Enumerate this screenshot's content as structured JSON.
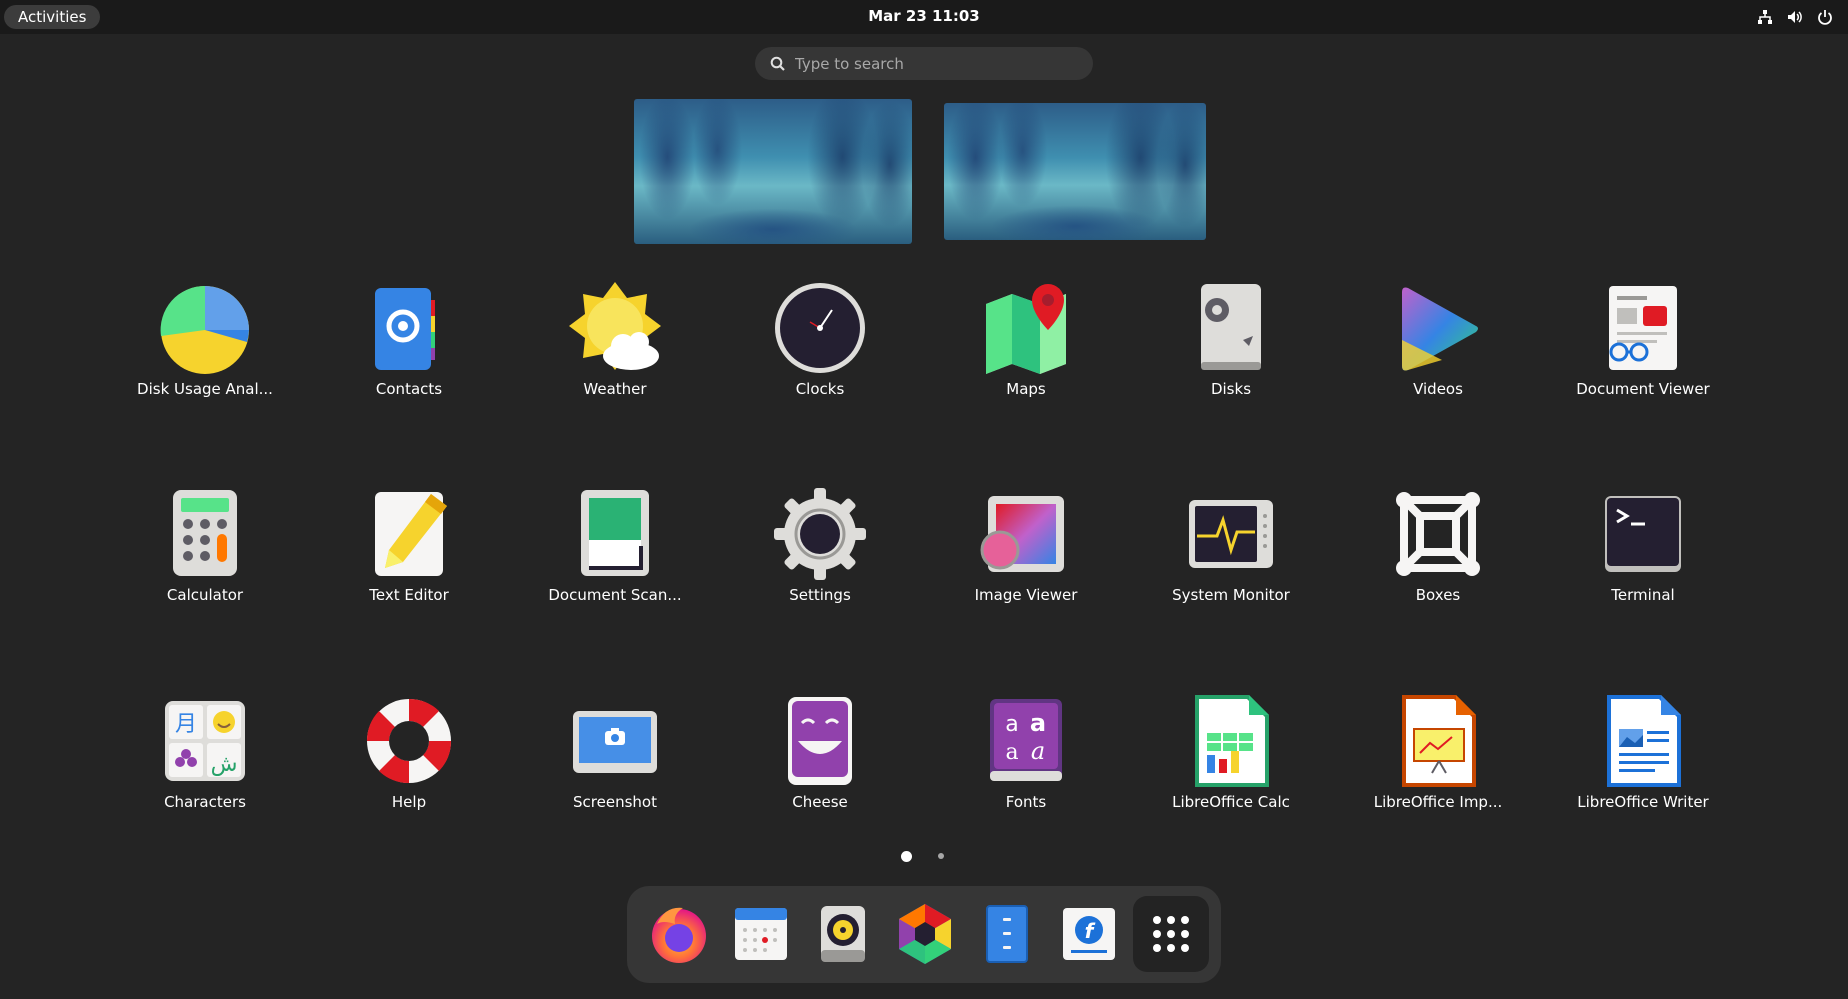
{
  "topbar": {
    "activities_label": "Activities",
    "datetime": "Mar 23  11:03",
    "tray_icons": [
      "network-icon",
      "volume-icon",
      "power-icon"
    ]
  },
  "search": {
    "placeholder": "Type to search"
  },
  "apps": [
    {
      "label": "Disk Usage Anal...",
      "icon": "disk-usage-icon"
    },
    {
      "label": "Contacts",
      "icon": "contacts-icon"
    },
    {
      "label": "Weather",
      "icon": "weather-icon"
    },
    {
      "label": "Clocks",
      "icon": "clocks-icon"
    },
    {
      "label": "Maps",
      "icon": "maps-icon"
    },
    {
      "label": "Disks",
      "icon": "disks-icon"
    },
    {
      "label": "Videos",
      "icon": "videos-icon"
    },
    {
      "label": "Document Viewer",
      "icon": "document-viewer-icon"
    },
    {
      "label": "Calculator",
      "icon": "calculator-icon"
    },
    {
      "label": "Text Editor",
      "icon": "text-editor-icon"
    },
    {
      "label": "Document Scan...",
      "icon": "document-scanner-icon"
    },
    {
      "label": "Settings",
      "icon": "settings-icon"
    },
    {
      "label": "Image Viewer",
      "icon": "image-viewer-icon"
    },
    {
      "label": "System Monitor",
      "icon": "system-monitor-icon"
    },
    {
      "label": "Boxes",
      "icon": "boxes-icon"
    },
    {
      "label": "Terminal",
      "icon": "terminal-icon"
    },
    {
      "label": "Characters",
      "icon": "characters-icon"
    },
    {
      "label": "Help",
      "icon": "help-icon"
    },
    {
      "label": "Screenshot",
      "icon": "screenshot-icon"
    },
    {
      "label": "Cheese",
      "icon": "cheese-icon"
    },
    {
      "label": "Fonts",
      "icon": "fonts-icon"
    },
    {
      "label": "LibreOffice Calc",
      "icon": "libreoffice-calc-icon"
    },
    {
      "label": "LibreOffice Imp...",
      "icon": "libreoffice-impress-icon"
    },
    {
      "label": "LibreOffice Writer",
      "icon": "libreoffice-writer-icon"
    }
  ],
  "pagination": {
    "pages": 2,
    "current": 1
  },
  "dash": [
    {
      "icon": "firefox-icon"
    },
    {
      "icon": "calendar-icon"
    },
    {
      "icon": "rhythmbox-icon"
    },
    {
      "icon": "software-icon"
    },
    {
      "icon": "files-icon"
    },
    {
      "icon": "fedora-icon"
    },
    {
      "icon": "show-apps-icon"
    }
  ]
}
